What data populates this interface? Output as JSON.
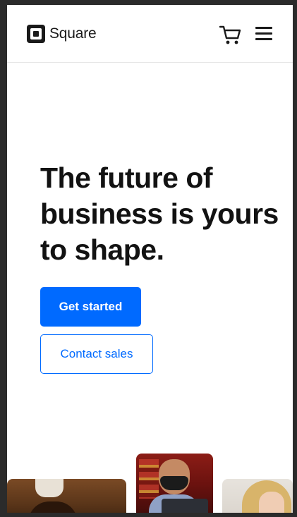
{
  "header": {
    "brand_name": "Square",
    "icons": {
      "logo": "square-logo-icon",
      "cart": "shopping-cart-icon",
      "menu": "hamburger-menu-icon"
    }
  },
  "hero": {
    "title": "The future of business is yours to shape.",
    "primary_cta": "Get started",
    "secondary_cta": "Contact sales"
  },
  "colors": {
    "accent": "#006aff",
    "text": "#121212",
    "background": "#ffffff"
  }
}
